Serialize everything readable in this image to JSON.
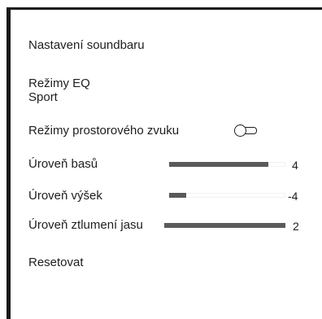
{
  "menu": {
    "title": "Nastavení soundbaru",
    "eq": {
      "label": "Režimy EQ",
      "value": "Sport"
    },
    "surround": {
      "label": "Režimy prostorového zvuku",
      "state": "off"
    },
    "bass": {
      "label": "Úroveň basů",
      "value": "4",
      "level_fraction": 0.85
    },
    "treble": {
      "label": "Úroveň výšek",
      "value": "-4",
      "level_fraction": 0.15
    },
    "dimmer": {
      "label": "Úroveň ztlumení jasu",
      "value": "2",
      "level_fraction": 1.0
    },
    "reset": {
      "label": "Resetovat"
    }
  }
}
